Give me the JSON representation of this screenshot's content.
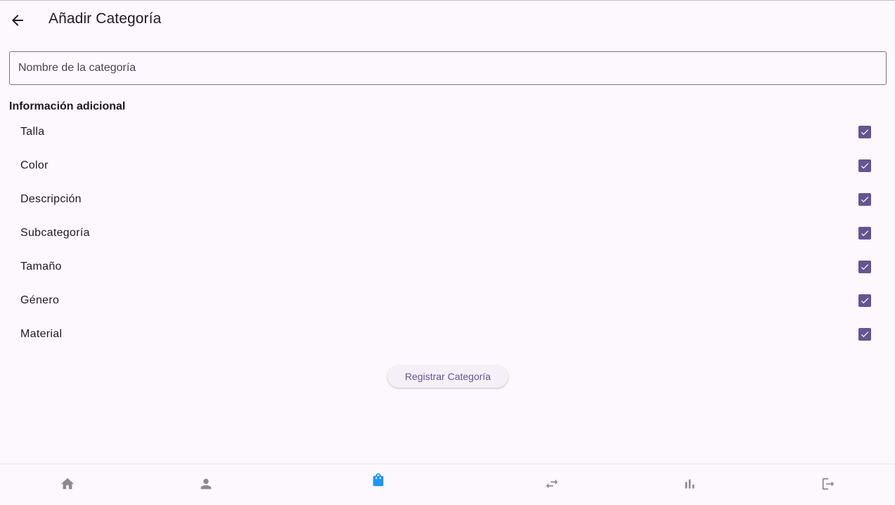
{
  "app_bar": {
    "back_icon": "arrow-back-icon",
    "title": "Añadir Categoría"
  },
  "form": {
    "name_placeholder": "Nombre de la categoría",
    "name_value": "",
    "section_title": "Información adicional",
    "options": [
      {
        "label": "Talla",
        "checked": true
      },
      {
        "label": "Color",
        "checked": true
      },
      {
        "label": "Descripción",
        "checked": true
      },
      {
        "label": "Subcategoría",
        "checked": true
      },
      {
        "label": "Tamaño",
        "checked": true
      },
      {
        "label": "Género",
        "checked": true
      },
      {
        "label": "Material",
        "checked": true
      }
    ],
    "submit_label": "Registrar Categoría"
  },
  "bottom_nav": {
    "items": [
      {
        "icon": "home-icon",
        "active": false
      },
      {
        "icon": "person-icon",
        "active": false
      },
      {
        "icon": "shopping-bag-icon",
        "active": true
      },
      {
        "icon": "swap-horiz-icon",
        "active": false
      },
      {
        "icon": "bar-chart-icon",
        "active": false
      },
      {
        "icon": "logout-icon",
        "active": false
      }
    ]
  },
  "colors": {
    "background": "#fdf7fe",
    "primary": "#65558f",
    "active_nav": "#2196f3",
    "inactive_nav": "#8a8a8a"
  }
}
